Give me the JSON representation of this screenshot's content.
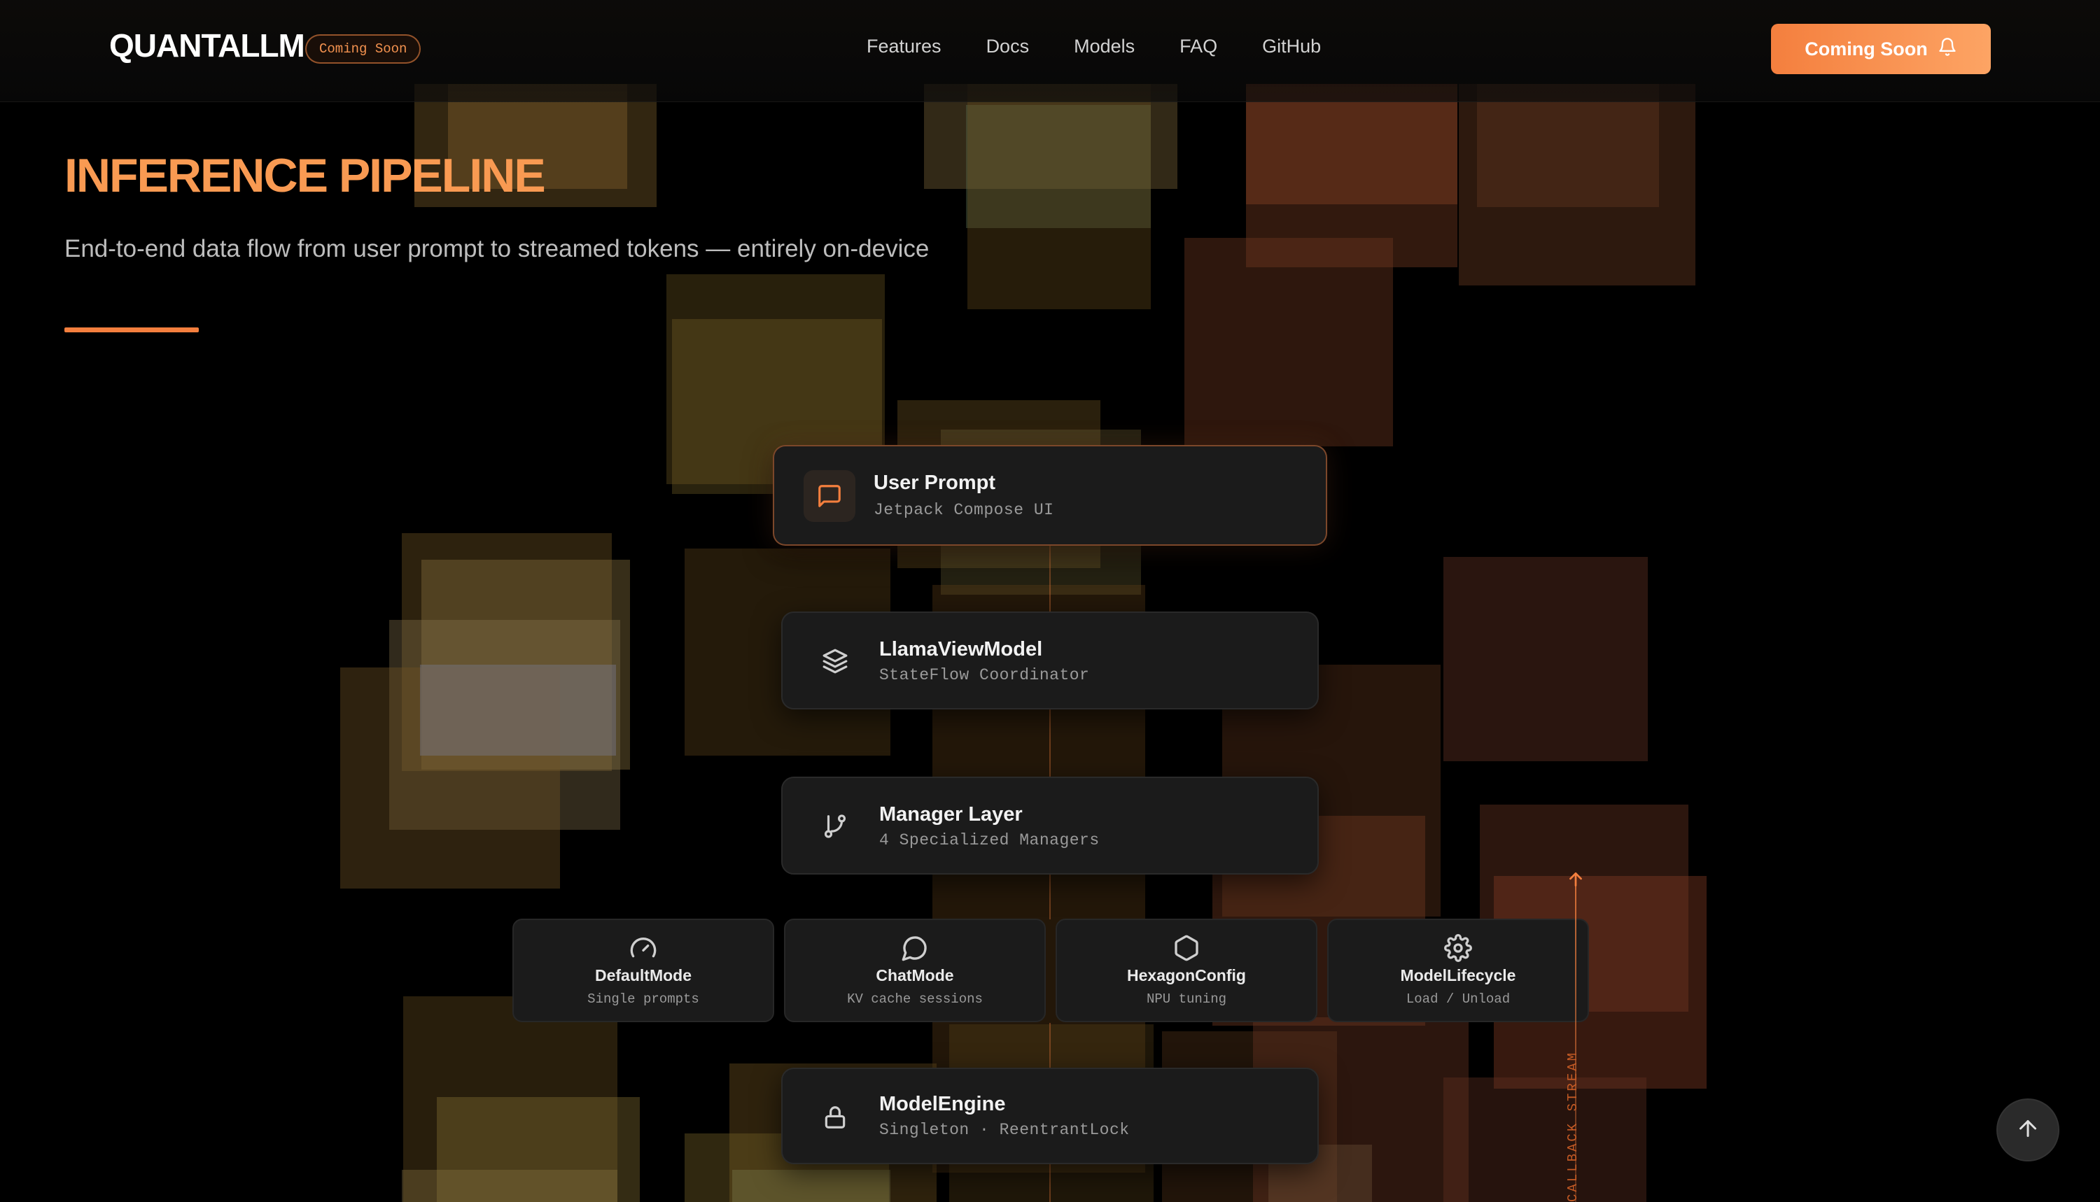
{
  "nav": {
    "logo": "QUANTALLM",
    "badge": "Coming Soon",
    "links": [
      "Features",
      "Docs",
      "Models",
      "FAQ",
      "GitHub"
    ],
    "cta_label": "Coming Soon",
    "cta_icon": "bell-icon"
  },
  "hero": {
    "title": "INFERENCE PIPELINE",
    "subtitle": "End-to-end data flow from user prompt to streamed tokens — entirely on-device"
  },
  "pipeline": {
    "stages": [
      {
        "title": "User Prompt",
        "subtitle": "Jetpack Compose UI",
        "icon": "message-square-icon"
      },
      {
        "title": "LlamaViewModel",
        "subtitle": "StateFlow Coordinator",
        "icon": "layers-icon"
      },
      {
        "title": "Manager Layer",
        "subtitle": "4 Specialized Managers",
        "icon": "git-branch-icon"
      },
      {
        "title": "ModelEngine",
        "subtitle": "Singleton · ReentrantLock",
        "icon": "lock-icon"
      }
    ],
    "managers": [
      {
        "title": "DefaultMode",
        "subtitle": "Single prompts",
        "icon": "gauge-icon"
      },
      {
        "title": "ChatMode",
        "subtitle": "KV cache sessions",
        "icon": "message-circle-icon"
      },
      {
        "title": "HexagonConfig",
        "subtitle": "NPU tuning",
        "icon": "hexagon-icon"
      },
      {
        "title": "ModelLifecycle",
        "subtitle": "Load / Unload",
        "icon": "settings-icon"
      }
    ],
    "stream_label": "CALLBACK STREAM"
  },
  "colors": {
    "accent": "#f47f3e",
    "accent_light": "#fda464",
    "card_bg": "#1b1b1b",
    "page_bg": "#000000"
  }
}
